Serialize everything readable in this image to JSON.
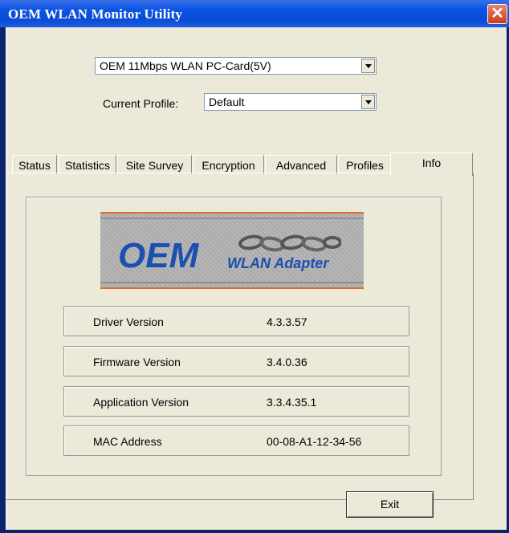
{
  "window": {
    "title": "OEM WLAN Monitor Utility"
  },
  "adapter_select": {
    "value": "OEM 11Mbps WLAN PC-Card(5V)"
  },
  "profile": {
    "label": "Current Profile:",
    "value": "Default"
  },
  "tabs": [
    {
      "label": "Status"
    },
    {
      "label": "Statistics"
    },
    {
      "label": "Site Survey"
    },
    {
      "label": "Encryption"
    },
    {
      "label": "Advanced"
    },
    {
      "label": "Profiles"
    },
    {
      "label": "Info",
      "active": true
    }
  ],
  "logo": {
    "brand": "OEM",
    "subtitle": "WLAN Adapter"
  },
  "info": [
    {
      "label": "Driver Version",
      "value": "4.3.3.57"
    },
    {
      "label": "Firmware Version",
      "value": "3.4.0.36"
    },
    {
      "label": "Application Version",
      "value": "3.3.4.35.1"
    },
    {
      "label": "MAC Address",
      "value": "00-08-A1-12-34-56"
    }
  ],
  "buttons": {
    "exit": "Exit"
  },
  "colors": {
    "title_bar": "#0b54e4",
    "dialog_bg": "#ece9d8",
    "logo_accent": "#e06a2a",
    "logo_text": "#1b4fb0"
  }
}
